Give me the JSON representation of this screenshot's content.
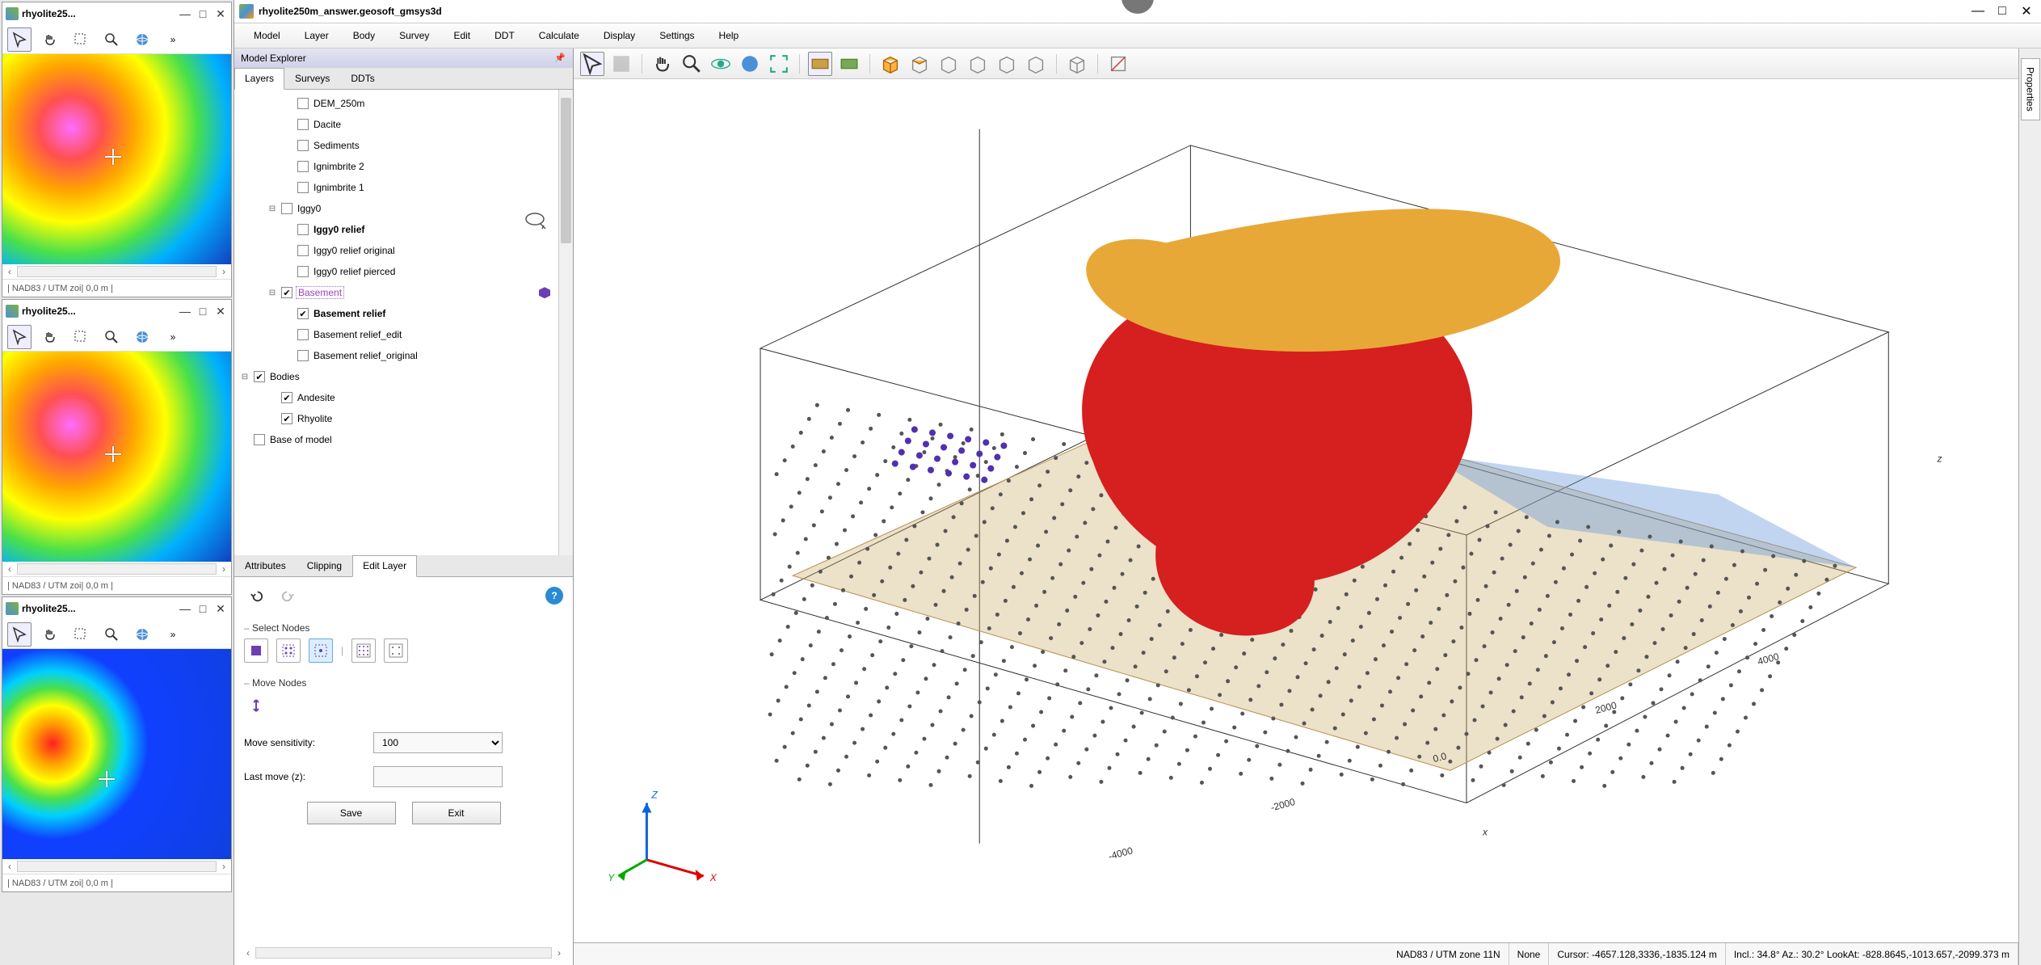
{
  "left_panels": [
    {
      "title": "rhyolite25...",
      "status": "| NAD83 / UTM zoi| 0,0 m |"
    },
    {
      "title": "rhyolite25...",
      "status": "| NAD83 / UTM zoi| 0,0 m |"
    },
    {
      "title": "rhyolite25...",
      "status": "| NAD83 / UTM zoi| 0,0 m |"
    }
  ],
  "main_title": "rhyolite250m_answer.geosoft_gmsys3d",
  "menu": [
    "Model",
    "Layer",
    "Body",
    "Survey",
    "Edit",
    "DDT",
    "Calculate",
    "Display",
    "Settings",
    "Help"
  ],
  "explorer": {
    "title": "Model Explorer",
    "tabs": [
      "Layers",
      "Surveys",
      "DDTs"
    ],
    "active_tab": 0,
    "tree": [
      {
        "indent": 2,
        "twisty": "",
        "checked": false,
        "label": "DEM_250m"
      },
      {
        "indent": 2,
        "twisty": "",
        "checked": false,
        "label": "Dacite"
      },
      {
        "indent": 2,
        "twisty": "",
        "checked": false,
        "label": "Sediments"
      },
      {
        "indent": 2,
        "twisty": "",
        "checked": false,
        "label": "Ignimbrite 2"
      },
      {
        "indent": 2,
        "twisty": "",
        "checked": false,
        "label": "Ignimbrite 1"
      },
      {
        "indent": 1,
        "twisty": "⊟",
        "checked": false,
        "label": "Iggy0"
      },
      {
        "indent": 2,
        "twisty": "",
        "checked": false,
        "label": "Iggy0 relief",
        "bold": true
      },
      {
        "indent": 2,
        "twisty": "",
        "checked": false,
        "label": "Iggy0 relief original"
      },
      {
        "indent": 2,
        "twisty": "",
        "checked": false,
        "label": "Iggy0 relief pierced"
      },
      {
        "indent": 1,
        "twisty": "⊟",
        "checked": true,
        "label": "Basement",
        "selected": true,
        "badge": "purple"
      },
      {
        "indent": 2,
        "twisty": "",
        "checked": true,
        "label": "Basement relief",
        "bold": true
      },
      {
        "indent": 2,
        "twisty": "",
        "checked": false,
        "label": "Basement relief_edit"
      },
      {
        "indent": 2,
        "twisty": "",
        "checked": false,
        "label": "Basement relief_original"
      },
      {
        "indent": 0,
        "twisty": "⊟",
        "checked": true,
        "label": "Bodies"
      },
      {
        "indent": 1,
        "twisty": "",
        "checked": true,
        "label": "Andesite"
      },
      {
        "indent": 1,
        "twisty": "",
        "checked": true,
        "label": "Rhyolite"
      },
      {
        "indent": 0,
        "twisty": "",
        "checked": false,
        "label": "Base of model"
      }
    ]
  },
  "bottom_tabs": {
    "tabs": [
      "Attributes",
      "Clipping",
      "Edit Layer"
    ],
    "active": 2
  },
  "edit_layer": {
    "select_label": "Select Nodes",
    "move_label": "Move Nodes",
    "sensitivity_label": "Move sensitivity:",
    "sensitivity_value": "100",
    "last_move_label": "Last move (z):",
    "last_move_value": "",
    "save": "Save",
    "exit": "Exit"
  },
  "status": {
    "proj": "NAD83 / UTM zone 11N",
    "snap": "None",
    "cursor": "Cursor: -4657.128,3336,-1835.124 m",
    "view": "Incl.: 34.8° Az.: 30.2° LookAt: -828.8645,-1013.657,-2099.373 m"
  },
  "axis_labels": {
    "x": "X",
    "y": "Y",
    "z": "Z",
    "x_lower": "x",
    "z_lower": "z"
  },
  "ticks_x": [
    "-4000",
    "-2000",
    "0.0",
    "2000",
    "4000"
  ],
  "right_tab": "Properties"
}
